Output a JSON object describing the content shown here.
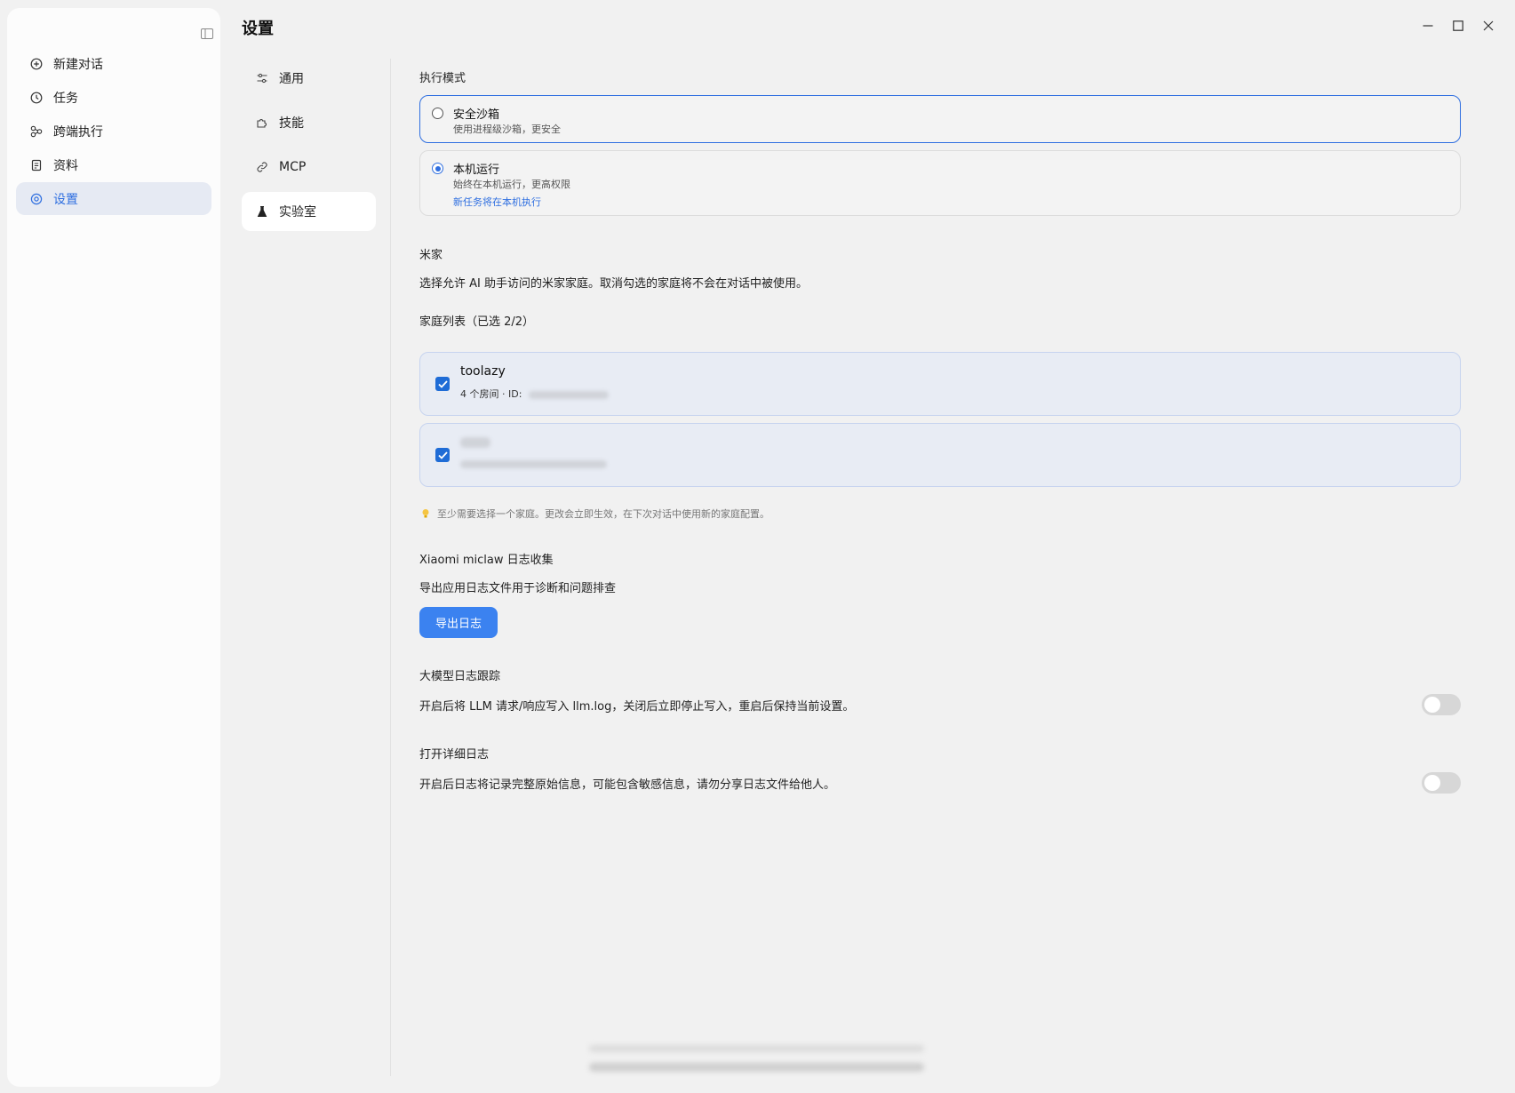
{
  "window": {
    "title": "设置",
    "controls": [
      "minimize-icon",
      "maximize-icon",
      "close-icon"
    ]
  },
  "sidebar": {
    "toggle_icon": "sidebar-toggle-icon",
    "items": [
      {
        "label": "新建对话",
        "icon": "plus-circle-icon",
        "active": false
      },
      {
        "label": "任务",
        "icon": "clock-icon",
        "active": false
      },
      {
        "label": "跨端执行",
        "icon": "share-nodes-icon",
        "active": false
      },
      {
        "label": "资料",
        "icon": "document-icon",
        "active": false
      },
      {
        "label": "设置",
        "icon": "gear-icon",
        "active": true
      }
    ]
  },
  "settings_nav": {
    "items": [
      {
        "label": "通用",
        "icon": "sliders-icon",
        "active": false
      },
      {
        "label": "技能",
        "icon": "puzzle-icon",
        "active": false
      },
      {
        "label": "MCP",
        "icon": "link-icon",
        "active": false
      },
      {
        "label": "实验室",
        "icon": "flask-icon",
        "active": true
      }
    ]
  },
  "execution_mode": {
    "heading": "执行模式",
    "options": [
      {
        "title": "安全沙箱",
        "subtitle": "使用进程级沙箱，更安全",
        "selected": false
      },
      {
        "title": "本机运行",
        "subtitle": "始终在本机运行，更高权限",
        "note": "新任务将在本机执行",
        "selected": true
      }
    ]
  },
  "mijia": {
    "heading": "米家",
    "description": "选择允许 AI 助手访问的米家家庭。取消勾选的家庭将不会在对话中被使用。",
    "list_label": "家庭列表（已选 2/2）",
    "homes": [
      {
        "name": "toolazy",
        "meta": "4 个房间 · ID:",
        "checked": true
      },
      {
        "name": "",
        "meta": "",
        "checked": true
      }
    ],
    "hint": "至少需要选择一个家庭。更改会立即生效，在下次对话中使用新的家庭配置。"
  },
  "logs": {
    "heading": "Xiaomi miclaw 日志收集",
    "description": "导出应用日志文件用于诊断和问题排查",
    "export_button": "导出日志"
  },
  "llm_trace": {
    "heading": "大模型日志跟踪",
    "description": "开启后将 LLM 请求/响应写入 llm.log，关闭后立即停止写入，重启后保持当前设置。",
    "enabled": false
  },
  "verbose_log": {
    "heading": "打开详细日志",
    "description": "开启后日志将记录完整原始信息，可能包含敏感信息，请勿分享日志文件给他人。",
    "enabled": false
  },
  "colors": {
    "accent": "#2f6fe0",
    "button": "#3b82f0",
    "checkbox": "#1f6cd6",
    "active_nav_bg": "#e6eaf3",
    "home_card_bg": "#e8ecf4"
  }
}
